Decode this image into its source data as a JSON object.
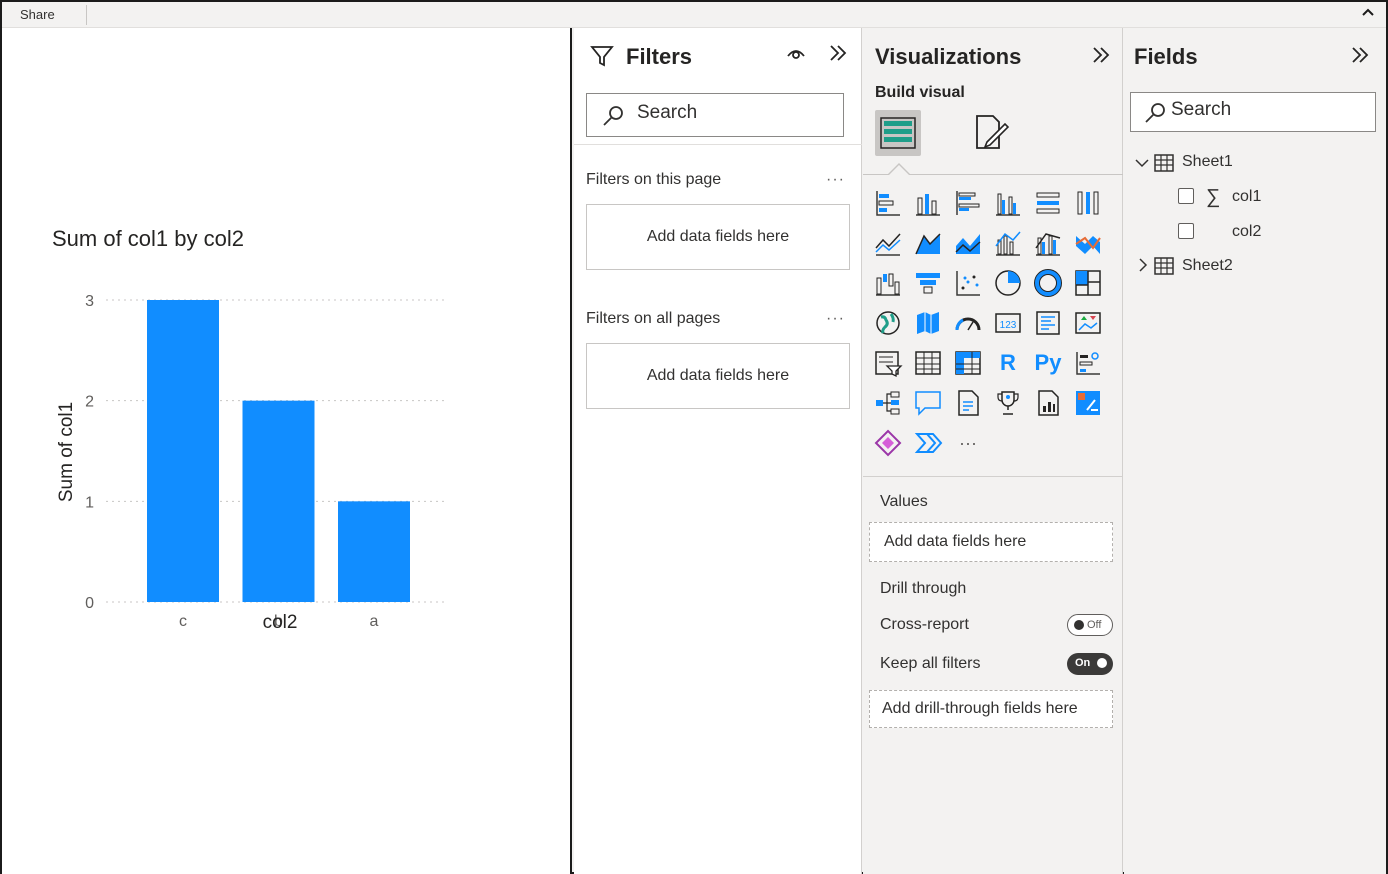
{
  "ribbon": {
    "share_label": "Share"
  },
  "chart": {
    "title": "Sum of col1 by col2"
  },
  "chart_data": {
    "type": "bar",
    "title": "Sum of col1 by col2",
    "categories": [
      "c",
      "b",
      "a"
    ],
    "values": [
      3,
      2,
      1
    ],
    "xlabel": "col2",
    "ylabel": "Sum of col1",
    "ylim": [
      0,
      3
    ],
    "yticks": [
      "0",
      "1",
      "2",
      "3"
    ],
    "grid": true,
    "bar_color": "#118dff"
  },
  "filters": {
    "title": "Filters",
    "search_placeholder": "Search",
    "this_page_label": "Filters on this page",
    "this_page_well": "Add data fields here",
    "all_pages_label": "Filters on all pages",
    "all_pages_well": "Add data fields here",
    "more": "···"
  },
  "visualizations": {
    "title": "Visualizations",
    "build_visual": "Build visual",
    "more_visuals": "···",
    "r_label": "R",
    "py_label": "Py",
    "values_label": "Values",
    "values_well": "Add data fields here",
    "drill_through": "Drill through",
    "cross_report": "Cross-report",
    "cross_report_state": "Off",
    "keep_all_filters": "Keep all filters",
    "keep_all_filters_state": "On",
    "drill_well": "Add drill-through fields here"
  },
  "fields": {
    "title": "Fields",
    "search_placeholder": "Search",
    "tables": [
      {
        "name": "Sheet1",
        "expanded": true,
        "columns": [
          {
            "name": "col1",
            "aggregate": true
          },
          {
            "name": "col2",
            "aggregate": false
          }
        ]
      },
      {
        "name": "Sheet2",
        "expanded": false
      }
    ],
    "sigma": "∑"
  },
  "colors": {
    "accent": "#118dff",
    "pane_bg": "#f3f2f1",
    "toggle_on": "#3b3a39"
  }
}
